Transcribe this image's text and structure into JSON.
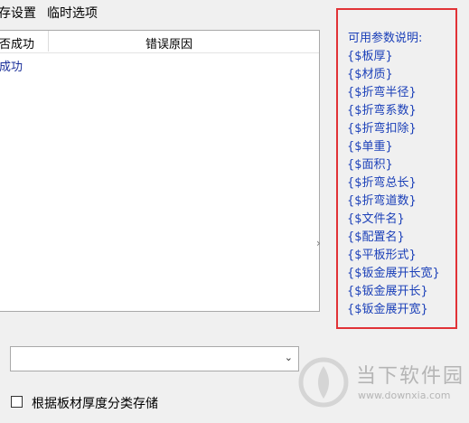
{
  "tabs": [
    "存设置",
    "临时选项"
  ],
  "results": {
    "columns": [
      "否成功",
      "错误原因"
    ],
    "rows": [
      {
        "success": "成功",
        "error": ""
      }
    ]
  },
  "help": {
    "title": "可用参数说明:",
    "params": [
      "{$板厚}",
      "{$材质}",
      "{$折弯半径}",
      "{$折弯系数}",
      "{$折弯扣除}",
      "{$单重}",
      "{$面积}",
      "{$折弯总长}",
      "{$折弯道数}",
      "{$文件名}",
      "{$配置名}",
      "{$平板形式}",
      "{$钣金展开长宽}",
      "{$钣金展开长}",
      "{$钣金展开宽}"
    ]
  },
  "dropdown": {
    "value": "",
    "chevron": "⌄"
  },
  "checkbox": {
    "label": "根据板材厚度分类存储",
    "checked": false
  },
  "watermark": {
    "name": "当下软件园",
    "url": "www.downxia.com"
  }
}
